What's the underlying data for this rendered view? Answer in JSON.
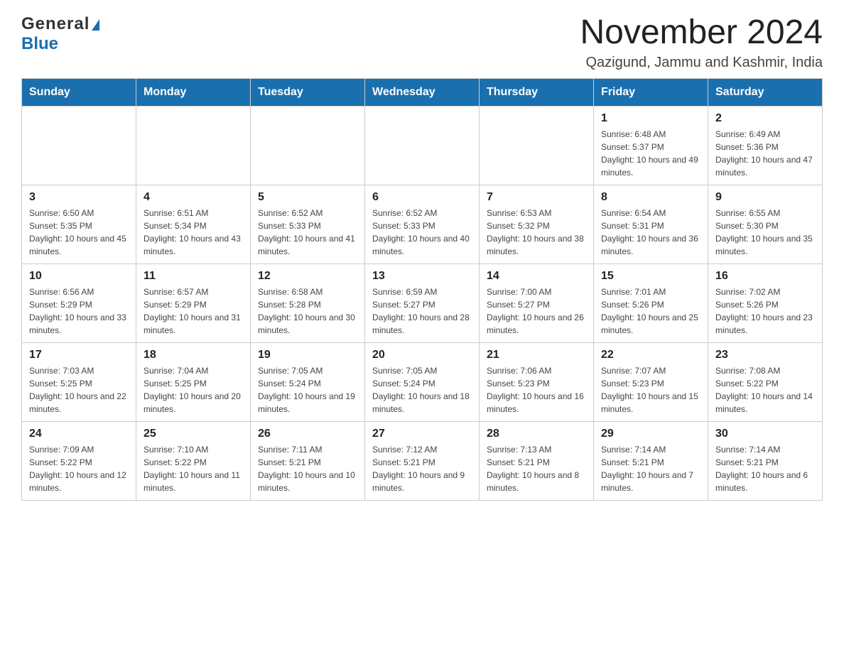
{
  "logo": {
    "general": "General",
    "blue": "Blue"
  },
  "title": "November 2024",
  "subtitle": "Qazigund, Jammu and Kashmir, India",
  "days_of_week": [
    "Sunday",
    "Monday",
    "Tuesday",
    "Wednesday",
    "Thursday",
    "Friday",
    "Saturday"
  ],
  "weeks": [
    [
      {
        "day": "",
        "info": ""
      },
      {
        "day": "",
        "info": ""
      },
      {
        "day": "",
        "info": ""
      },
      {
        "day": "",
        "info": ""
      },
      {
        "day": "",
        "info": ""
      },
      {
        "day": "1",
        "info": "Sunrise: 6:48 AM\nSunset: 5:37 PM\nDaylight: 10 hours and 49 minutes."
      },
      {
        "day": "2",
        "info": "Sunrise: 6:49 AM\nSunset: 5:36 PM\nDaylight: 10 hours and 47 minutes."
      }
    ],
    [
      {
        "day": "3",
        "info": "Sunrise: 6:50 AM\nSunset: 5:35 PM\nDaylight: 10 hours and 45 minutes."
      },
      {
        "day": "4",
        "info": "Sunrise: 6:51 AM\nSunset: 5:34 PM\nDaylight: 10 hours and 43 minutes."
      },
      {
        "day": "5",
        "info": "Sunrise: 6:52 AM\nSunset: 5:33 PM\nDaylight: 10 hours and 41 minutes."
      },
      {
        "day": "6",
        "info": "Sunrise: 6:52 AM\nSunset: 5:33 PM\nDaylight: 10 hours and 40 minutes."
      },
      {
        "day": "7",
        "info": "Sunrise: 6:53 AM\nSunset: 5:32 PM\nDaylight: 10 hours and 38 minutes."
      },
      {
        "day": "8",
        "info": "Sunrise: 6:54 AM\nSunset: 5:31 PM\nDaylight: 10 hours and 36 minutes."
      },
      {
        "day": "9",
        "info": "Sunrise: 6:55 AM\nSunset: 5:30 PM\nDaylight: 10 hours and 35 minutes."
      }
    ],
    [
      {
        "day": "10",
        "info": "Sunrise: 6:56 AM\nSunset: 5:29 PM\nDaylight: 10 hours and 33 minutes."
      },
      {
        "day": "11",
        "info": "Sunrise: 6:57 AM\nSunset: 5:29 PM\nDaylight: 10 hours and 31 minutes."
      },
      {
        "day": "12",
        "info": "Sunrise: 6:58 AM\nSunset: 5:28 PM\nDaylight: 10 hours and 30 minutes."
      },
      {
        "day": "13",
        "info": "Sunrise: 6:59 AM\nSunset: 5:27 PM\nDaylight: 10 hours and 28 minutes."
      },
      {
        "day": "14",
        "info": "Sunrise: 7:00 AM\nSunset: 5:27 PM\nDaylight: 10 hours and 26 minutes."
      },
      {
        "day": "15",
        "info": "Sunrise: 7:01 AM\nSunset: 5:26 PM\nDaylight: 10 hours and 25 minutes."
      },
      {
        "day": "16",
        "info": "Sunrise: 7:02 AM\nSunset: 5:26 PM\nDaylight: 10 hours and 23 minutes."
      }
    ],
    [
      {
        "day": "17",
        "info": "Sunrise: 7:03 AM\nSunset: 5:25 PM\nDaylight: 10 hours and 22 minutes."
      },
      {
        "day": "18",
        "info": "Sunrise: 7:04 AM\nSunset: 5:25 PM\nDaylight: 10 hours and 20 minutes."
      },
      {
        "day": "19",
        "info": "Sunrise: 7:05 AM\nSunset: 5:24 PM\nDaylight: 10 hours and 19 minutes."
      },
      {
        "day": "20",
        "info": "Sunrise: 7:05 AM\nSunset: 5:24 PM\nDaylight: 10 hours and 18 minutes."
      },
      {
        "day": "21",
        "info": "Sunrise: 7:06 AM\nSunset: 5:23 PM\nDaylight: 10 hours and 16 minutes."
      },
      {
        "day": "22",
        "info": "Sunrise: 7:07 AM\nSunset: 5:23 PM\nDaylight: 10 hours and 15 minutes."
      },
      {
        "day": "23",
        "info": "Sunrise: 7:08 AM\nSunset: 5:22 PM\nDaylight: 10 hours and 14 minutes."
      }
    ],
    [
      {
        "day": "24",
        "info": "Sunrise: 7:09 AM\nSunset: 5:22 PM\nDaylight: 10 hours and 12 minutes."
      },
      {
        "day": "25",
        "info": "Sunrise: 7:10 AM\nSunset: 5:22 PM\nDaylight: 10 hours and 11 minutes."
      },
      {
        "day": "26",
        "info": "Sunrise: 7:11 AM\nSunset: 5:21 PM\nDaylight: 10 hours and 10 minutes."
      },
      {
        "day": "27",
        "info": "Sunrise: 7:12 AM\nSunset: 5:21 PM\nDaylight: 10 hours and 9 minutes."
      },
      {
        "day": "28",
        "info": "Sunrise: 7:13 AM\nSunset: 5:21 PM\nDaylight: 10 hours and 8 minutes."
      },
      {
        "day": "29",
        "info": "Sunrise: 7:14 AM\nSunset: 5:21 PM\nDaylight: 10 hours and 7 minutes."
      },
      {
        "day": "30",
        "info": "Sunrise: 7:14 AM\nSunset: 5:21 PM\nDaylight: 10 hours and 6 minutes."
      }
    ]
  ]
}
